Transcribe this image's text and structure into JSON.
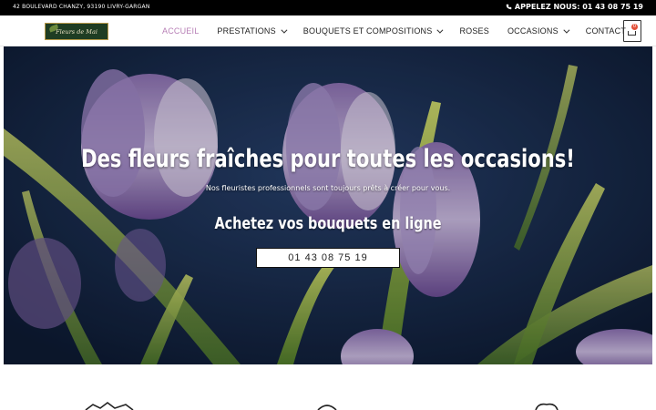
{
  "topbar": {
    "address": "42 BOULEVARD CHANZY, 93190 LIVRY-GARGAN",
    "phone_label": "APPELEZ NOUS: 01 43 08 75 19",
    "phone_icon": "phone-icon"
  },
  "logo": {
    "text": "Fleurs de Mai",
    "icon": "leaf-icon"
  },
  "menu": {
    "items": [
      {
        "label": "ACCUEIL",
        "active": true,
        "has_dropdown": false
      },
      {
        "label": "PRESTATIONS",
        "active": false,
        "has_dropdown": true
      },
      {
        "label": "BOUQUETS ET COMPOSITIONS",
        "active": false,
        "has_dropdown": true
      },
      {
        "label": "ROSES",
        "active": false,
        "has_dropdown": false
      },
      {
        "label": "OCCASIONS",
        "active": false,
        "has_dropdown": true
      },
      {
        "label": "CONTACT",
        "active": false,
        "has_dropdown": false
      }
    ]
  },
  "cart": {
    "count": "0",
    "icon": "cart-icon"
  },
  "hero": {
    "title": "Des fleurs fraîches pour toutes les occasions!",
    "subtitle": "Nos fleuristes professionnels sont toujours prêts à créer pour vous.",
    "heading2": "Achetez vos bouquets en ligne",
    "button_label": "01 43 08 75 19"
  },
  "colors": {
    "accent": "#b77fb6",
    "topbar_bg": "#000000",
    "hero_bg": "#14233f",
    "logo_bg": "#1f3d23"
  }
}
